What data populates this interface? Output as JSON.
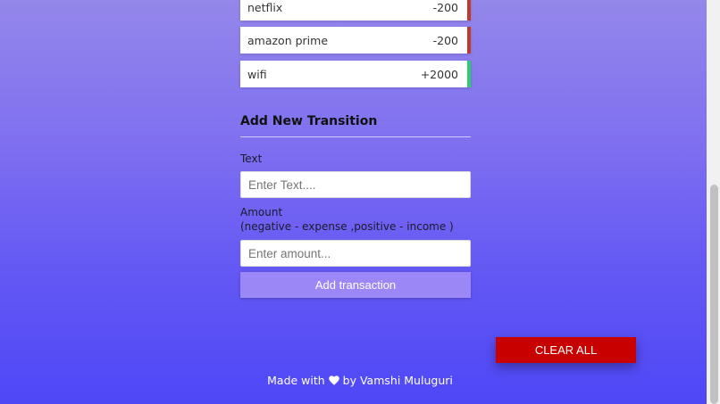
{
  "transactions": [
    {
      "text": "netflix",
      "amount": "-200",
      "type": "expense"
    },
    {
      "text": "amazon prime",
      "amount": "-200",
      "type": "expense"
    },
    {
      "text": "wifi",
      "amount": "+2000",
      "type": "income"
    }
  ],
  "form": {
    "title": "Add New Transition",
    "text_label": "Text",
    "text_placeholder": "Enter Text....",
    "amount_label": "Amount",
    "amount_hint": "(negative - expense ,positive - income )",
    "amount_placeholder": "Enter amount...",
    "submit_label": "Add transaction"
  },
  "clear_label": "CLEAR ALL",
  "footer": {
    "prefix": "Made with",
    "suffix": "by Vamshi Muluguri",
    "icon": "heart-icon"
  },
  "colors": {
    "expense_border": "#c0392b",
    "income_border": "#2ecc71",
    "add_button": "#9b87f5",
    "clear_button": "#c90000"
  }
}
